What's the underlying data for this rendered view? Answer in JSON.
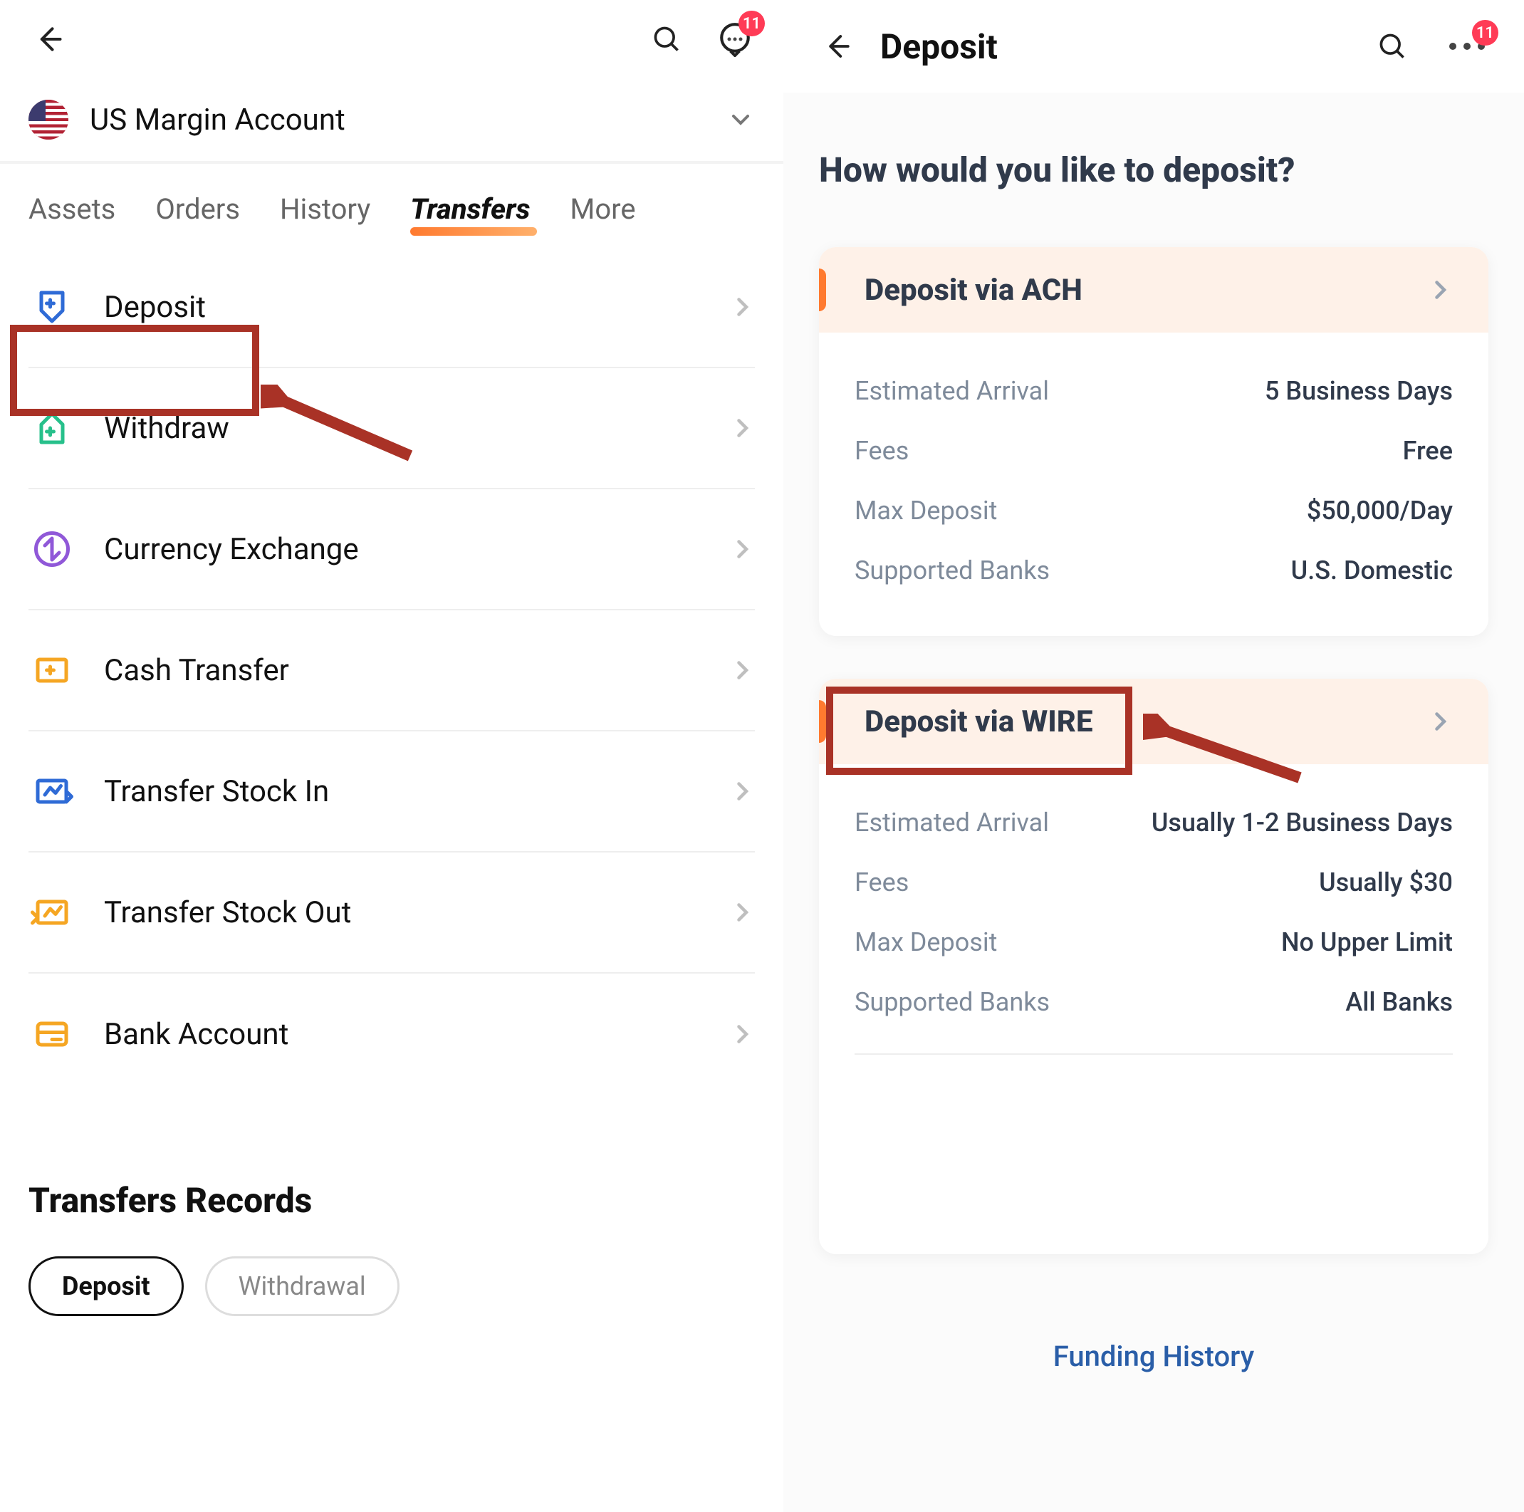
{
  "left": {
    "badge": "11",
    "account_name": "US Margin Account",
    "tabs": [
      "Assets",
      "Orders",
      "History",
      "Transfers",
      "More"
    ],
    "active_tab_index": 3,
    "items": [
      {
        "label": "Deposit",
        "icon": "deposit-icon",
        "color": "#2f6bd6"
      },
      {
        "label": "Withdraw",
        "icon": "withdraw-icon",
        "color": "#27c08b"
      },
      {
        "label": "Currency Exchange",
        "icon": "currency-exchange-icon",
        "color": "#9058d8"
      },
      {
        "label": "Cash Transfer",
        "icon": "cash-transfer-icon",
        "color": "#f5a623"
      },
      {
        "label": "Transfer Stock In",
        "icon": "transfer-stock-in-icon",
        "color": "#2f6bd6"
      },
      {
        "label": "Transfer Stock Out",
        "icon": "transfer-stock-out-icon",
        "color": "#f5a623"
      },
      {
        "label": "Bank Account",
        "icon": "bank-account-icon",
        "color": "#f5a623"
      }
    ],
    "records_title": "Transfers Records",
    "chips": [
      "Deposit",
      "Withdrawal"
    ],
    "active_chip_index": 0
  },
  "right": {
    "title": "Deposit",
    "badge": "11",
    "question": "How would you like to deposit?",
    "options": [
      {
        "title": "Deposit via ACH",
        "rows": [
          {
            "k": "Estimated Arrival",
            "v": "5 Business Days"
          },
          {
            "k": "Fees",
            "v": "Free"
          },
          {
            "k": "Max Deposit",
            "v": "$50,000/Day"
          },
          {
            "k": "Supported Banks",
            "v": "U.S. Domestic"
          }
        ]
      },
      {
        "title": "Deposit via WIRE",
        "rows": [
          {
            "k": "Estimated Arrival",
            "v": "Usually 1-2 Business Days"
          },
          {
            "k": "Fees",
            "v": "Usually $30"
          },
          {
            "k": "Max Deposit",
            "v": "No Upper Limit"
          },
          {
            "k": "Supported Banks",
            "v": "All Banks"
          }
        ]
      }
    ],
    "funding_history": "Funding History"
  },
  "annotations": {
    "highlight_left": "Deposit",
    "highlight_right": "Deposit via WIRE"
  }
}
